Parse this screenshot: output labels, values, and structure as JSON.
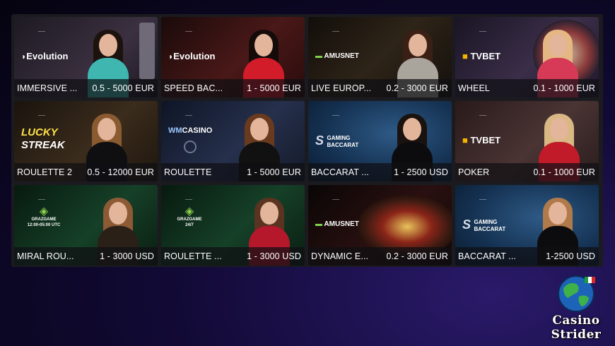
{
  "tiles": [
    {
      "name": "IMMERSIVE ...",
      "limit": "0.5 - 5000 EUR",
      "provider": "Evolution",
      "bg": "#2a2430"
    },
    {
      "name": "SPEED BAC...",
      "limit": "1 - 5000 EUR",
      "provider": "Evolution",
      "bg": "#3a1414"
    },
    {
      "name": "LIVE EUROP...",
      "limit": "0.2 - 3000 EUR",
      "provider": "AMUSNET",
      "bg": "#1c1812"
    },
    {
      "name": "WHEEL",
      "limit": "0.1 - 1000 EUR",
      "provider": "TVBET",
      "bg": "#2b2436"
    },
    {
      "name": "ROULETTE 2",
      "limit": "0.5 - 12000 EUR",
      "provider": "LUCKY STREAK",
      "bg": "#2b2219"
    },
    {
      "name": "ROULETTE",
      "limit": "1 - 5000 EUR",
      "provider": "WMCASINO",
      "bg": "#172033"
    },
    {
      "name": "BACCARAT ...",
      "limit": "1 - 2500 USD",
      "provider": "SA GAMING BACCARAT",
      "bg": "#16304a"
    },
    {
      "name": "POKER",
      "limit": "0.1 - 1000 EUR",
      "provider": "TVBET",
      "bg": "#3a2626"
    },
    {
      "name": "MIRAL ROU...",
      "limit": "1 - 3000 USD",
      "provider": "GRAZGAME",
      "provider_sub": "12:00-05:00 UTC",
      "bg": "#0f2a1a"
    },
    {
      "name": "ROULETTE ...",
      "limit": "1 - 3000 USD",
      "provider": "GRAZGAME",
      "provider_sub": "24/7",
      "bg": "#0f2a1a"
    },
    {
      "name": "DYNAMIC E...",
      "limit": "0.2 - 3000 EUR",
      "provider": "AMUSNET",
      "bg": "#1a0c0c"
    },
    {
      "name": "BACCARAT ...",
      "limit": "1-2500 USD",
      "provider": "SA GAMING BACCARAT",
      "bg": "#173556"
    }
  ],
  "logos": {
    "evolution": "Evolution",
    "amusnet": "AMUSNET",
    "tvbet": "TVBET",
    "lucky": "LUCKY",
    "streak": "STREAK",
    "wm": "WM",
    "casino": "CASINO",
    "sa_gaming": "GAMING",
    "sa_baccarat": "BACCARAT",
    "grazgame": "GRAZGAME",
    "graz_hours_1": "12:00-05:00 UTC",
    "graz_hours_2": "24/7"
  },
  "brand": {
    "line1": "Casino",
    "line2": "Strider"
  }
}
